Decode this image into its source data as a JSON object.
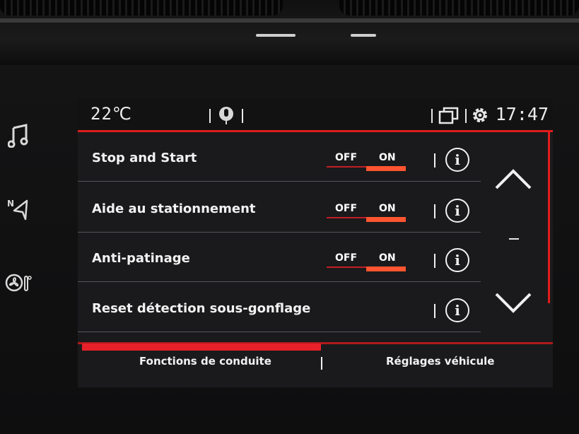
{
  "status_bar": {
    "temperature": "22℃",
    "clock": "17:47"
  },
  "side_buttons": [
    {
      "icon": "music-note-icon",
      "glyph": "♫"
    },
    {
      "icon": "navigation-icon",
      "glyph": "ᴺ◁"
    },
    {
      "icon": "climate-fan-icon",
      "glyph": "❄°"
    }
  ],
  "settings": [
    {
      "label": "Stop and Start",
      "off_label": "OFF",
      "on_label": "ON",
      "state": "ON",
      "has_toggle": true
    },
    {
      "label": "Aide au stationnement",
      "off_label": "OFF",
      "on_label": "ON",
      "state": "ON",
      "has_toggle": true
    },
    {
      "label": "Anti-patinage",
      "off_label": "OFF",
      "on_label": "ON",
      "state": "ON",
      "has_toggle": true
    },
    {
      "label": "Reset détection sous-gonflage",
      "has_toggle": false
    }
  ],
  "info_glyph": "i",
  "tabs": {
    "left": "Fonctions de conduite",
    "right": "Réglages véhicule",
    "active": "left"
  },
  "colors": {
    "accent_red": "#e01c1c",
    "toggle_on": "#ff5530",
    "screen_bg": "#1a1a1c"
  }
}
